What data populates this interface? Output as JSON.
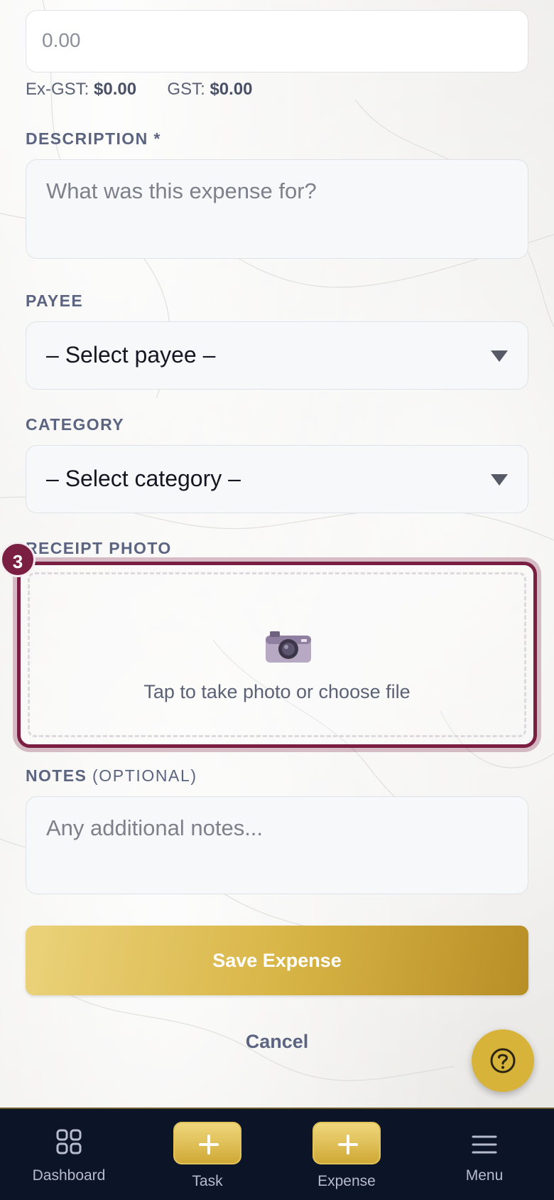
{
  "amount": {
    "placeholder": "0.00"
  },
  "gst": {
    "ex_gst_label": "Ex-GST:",
    "ex_gst_value": "$0.00",
    "gst_label": "GST:",
    "gst_value": "$0.00"
  },
  "description": {
    "label": "DESCRIPTION *",
    "placeholder": "What was this expense for?"
  },
  "payee": {
    "label": "PAYEE",
    "selected": "– Select payee –"
  },
  "category": {
    "label": "CATEGORY",
    "selected": "– Select category –"
  },
  "receipt": {
    "label": "RECEIPT PHOTO",
    "prompt": "Tap to take photo or choose file",
    "step_badge": "3",
    "icon": "camera-icon"
  },
  "notes": {
    "label": "NOTES",
    "optional": "(OPTIONAL)",
    "placeholder": "Any additional notes..."
  },
  "actions": {
    "save_label": "Save Expense",
    "cancel_label": "Cancel",
    "help_icon": "question-icon"
  },
  "nav": {
    "items": [
      {
        "label": "Dashboard",
        "icon": "grid-icon"
      },
      {
        "label": "Task",
        "icon": "plus-icon"
      },
      {
        "label": "Expense",
        "icon": "plus-icon"
      },
      {
        "label": "Menu",
        "icon": "hamburger-icon"
      }
    ]
  },
  "colors": {
    "accent_gold": "#d7b33a",
    "highlight_maroon": "#7a1f42",
    "nav_background": "#0c1428",
    "label_text": "#5b6480"
  }
}
